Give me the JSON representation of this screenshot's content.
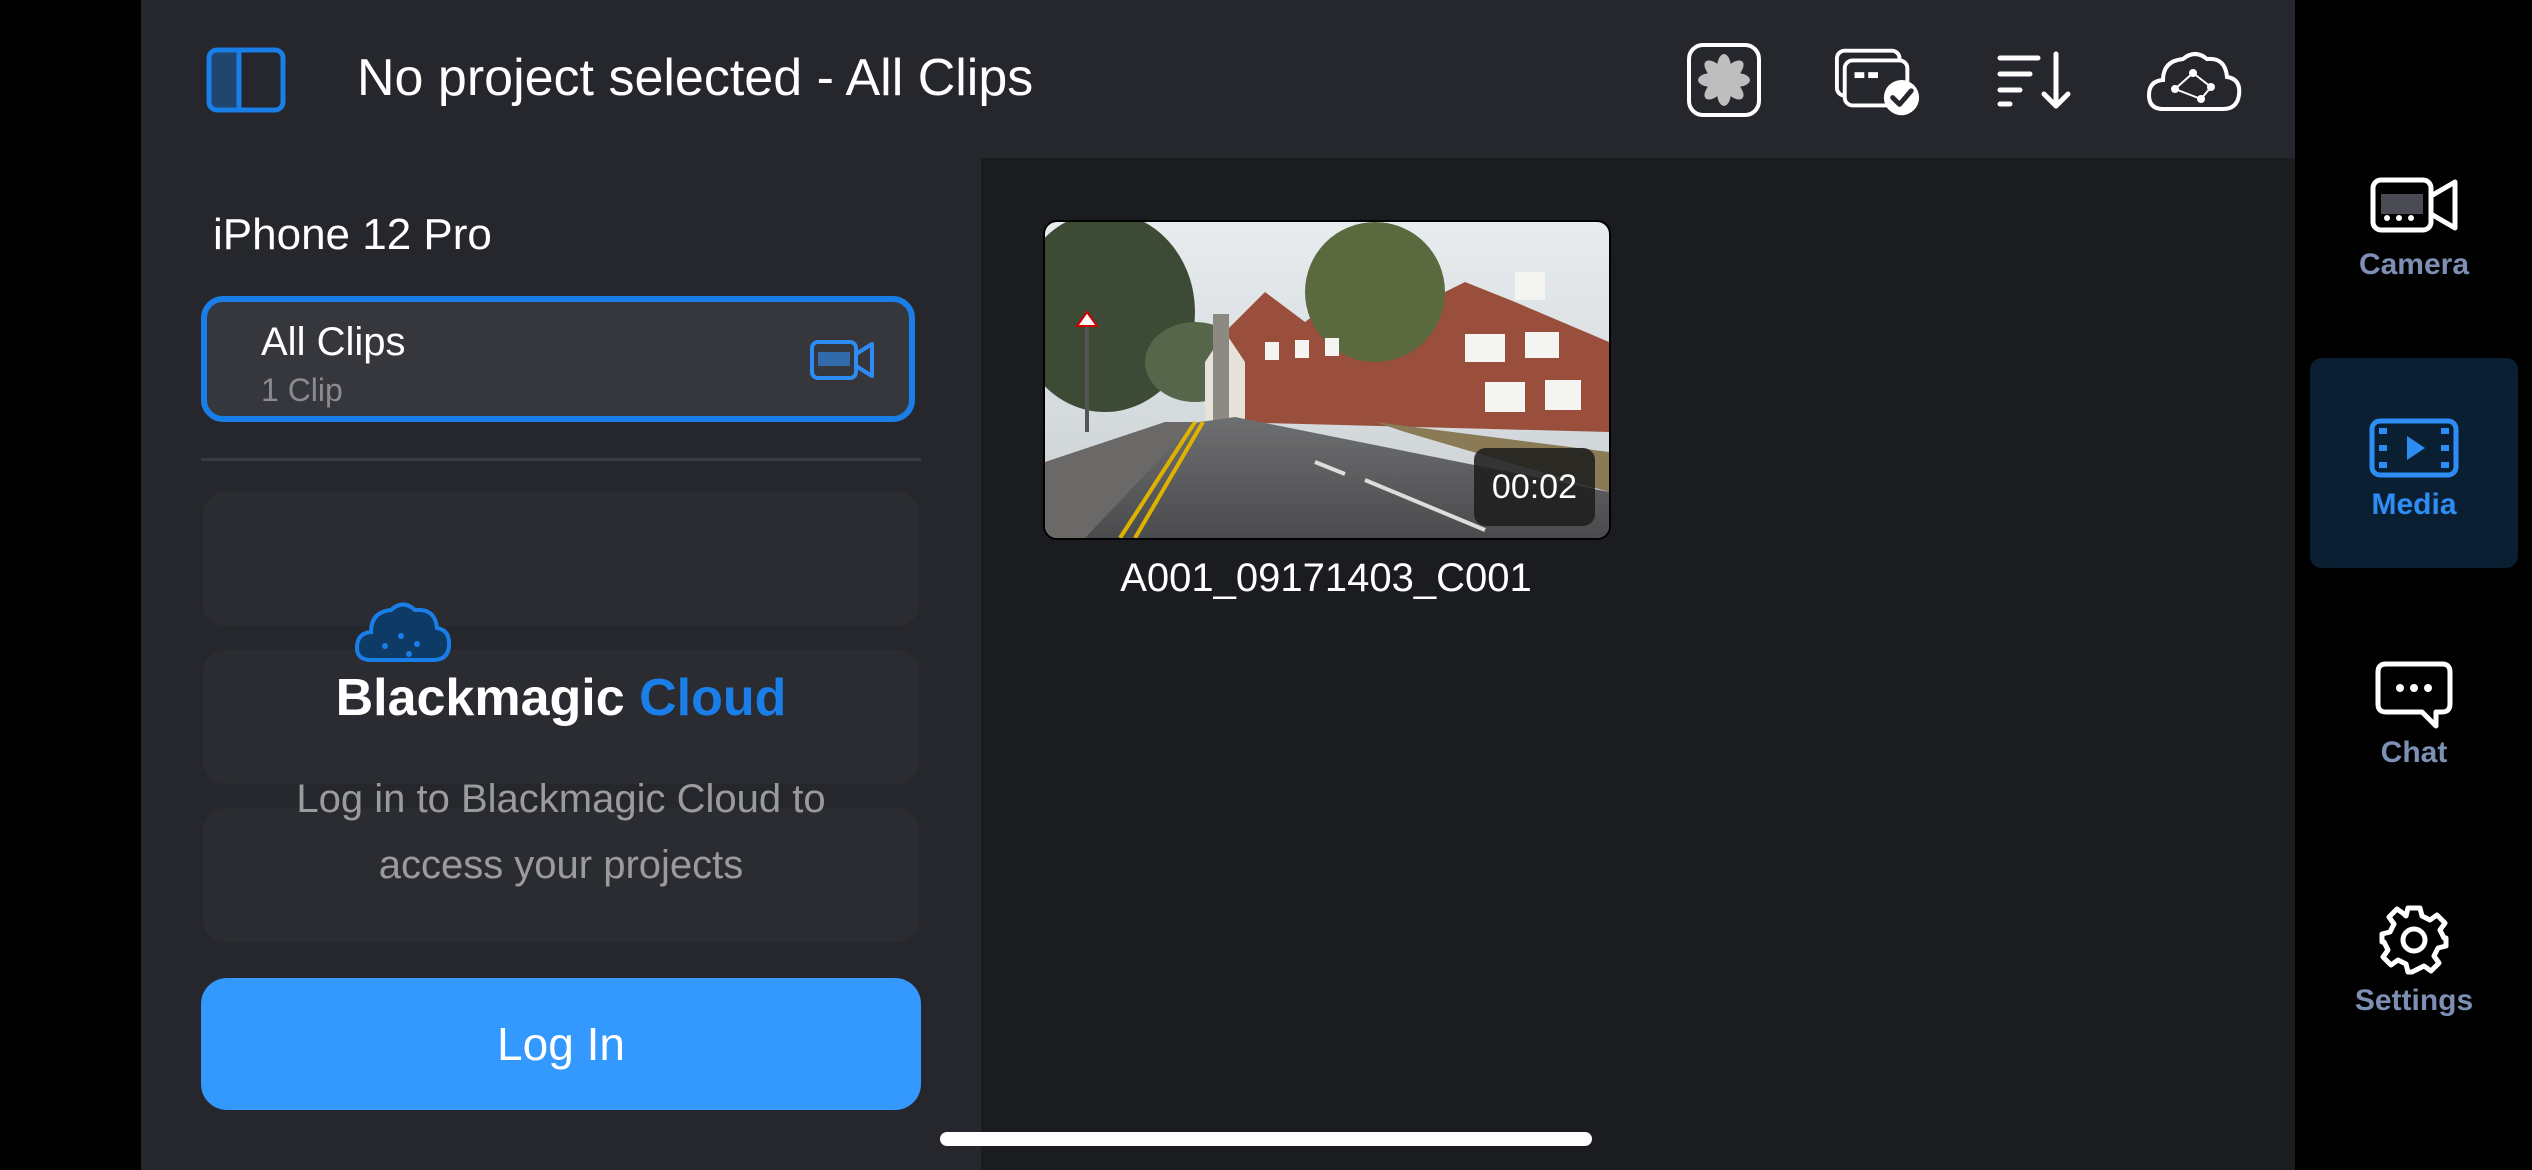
{
  "header": {
    "title": "No project selected - All Clips"
  },
  "left_panel": {
    "device_name": "iPhone 12 Pro",
    "all_clips": {
      "label": "All Clips",
      "count": "1 Clip"
    },
    "cloud": {
      "title_part1": "Blackmagic",
      "title_part2": "Cloud",
      "message": "Log in to Blackmagic Cloud to access your projects",
      "login_button": "Log In"
    }
  },
  "clips": [
    {
      "name": "A001_09171403_C001",
      "duration": "00:02"
    }
  ],
  "nav": {
    "items": [
      {
        "label": "Camera",
        "icon": "camera-icon"
      },
      {
        "label": "Media",
        "icon": "media-icon"
      },
      {
        "label": "Chat",
        "icon": "chat-icon"
      },
      {
        "label": "Settings",
        "icon": "gear-icon"
      }
    ],
    "active": "Media"
  },
  "colors": {
    "accent": "#1a7ee8",
    "login_button": "#3399ff",
    "nav_active": "#2e8df5",
    "nav_inactive": "#7d8fb5"
  }
}
